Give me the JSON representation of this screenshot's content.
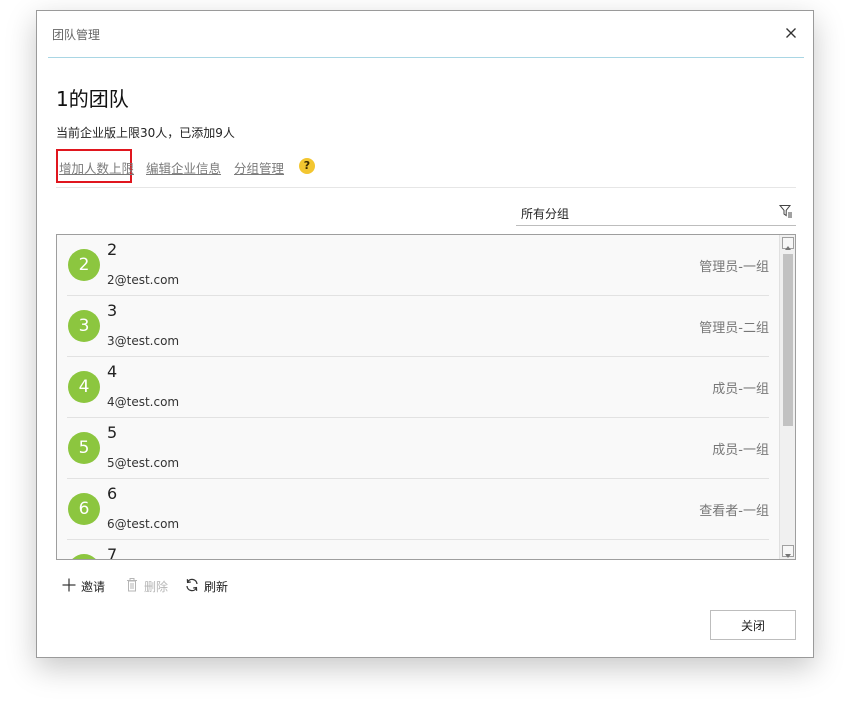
{
  "dialog": {
    "title": "团队管理",
    "team_name": "1的团队",
    "limit_text": "当前企业版上限30人，已添加9人",
    "links": {
      "increase_limit": "增加人数上限",
      "edit_info": "编辑企业信息",
      "group_manage": "分组管理",
      "help": "?"
    },
    "filter": {
      "selected": "所有分组"
    },
    "members": [
      {
        "avatar": "2",
        "name": "2",
        "email": "2@test.com",
        "role": "管理员-一组"
      },
      {
        "avatar": "3",
        "name": "3",
        "email": "3@test.com",
        "role": "管理员-二组"
      },
      {
        "avatar": "4",
        "name": "4",
        "email": "4@test.com",
        "role": "成员-一组"
      },
      {
        "avatar": "5",
        "name": "5",
        "email": "5@test.com",
        "role": "成员-一组"
      },
      {
        "avatar": "6",
        "name": "6",
        "email": "6@test.com",
        "role": "查看者-一组"
      },
      {
        "avatar": "7",
        "name": "7",
        "email": "",
        "role": ""
      }
    ],
    "toolbar": {
      "invite": "邀请",
      "delete": "删除",
      "refresh": "刷新"
    },
    "close_label": "关闭"
  },
  "colors": {
    "avatar_bg": "#8cc63f",
    "highlight": "#e0161e",
    "help_icon": "#f3c630",
    "title_rule": "#a9d6e4"
  },
  "icons": [
    "close-icon",
    "help-icon",
    "filter-icon",
    "plus-icon",
    "trash-icon",
    "refresh-icon",
    "scroll-up-icon",
    "scroll-down-icon"
  ]
}
